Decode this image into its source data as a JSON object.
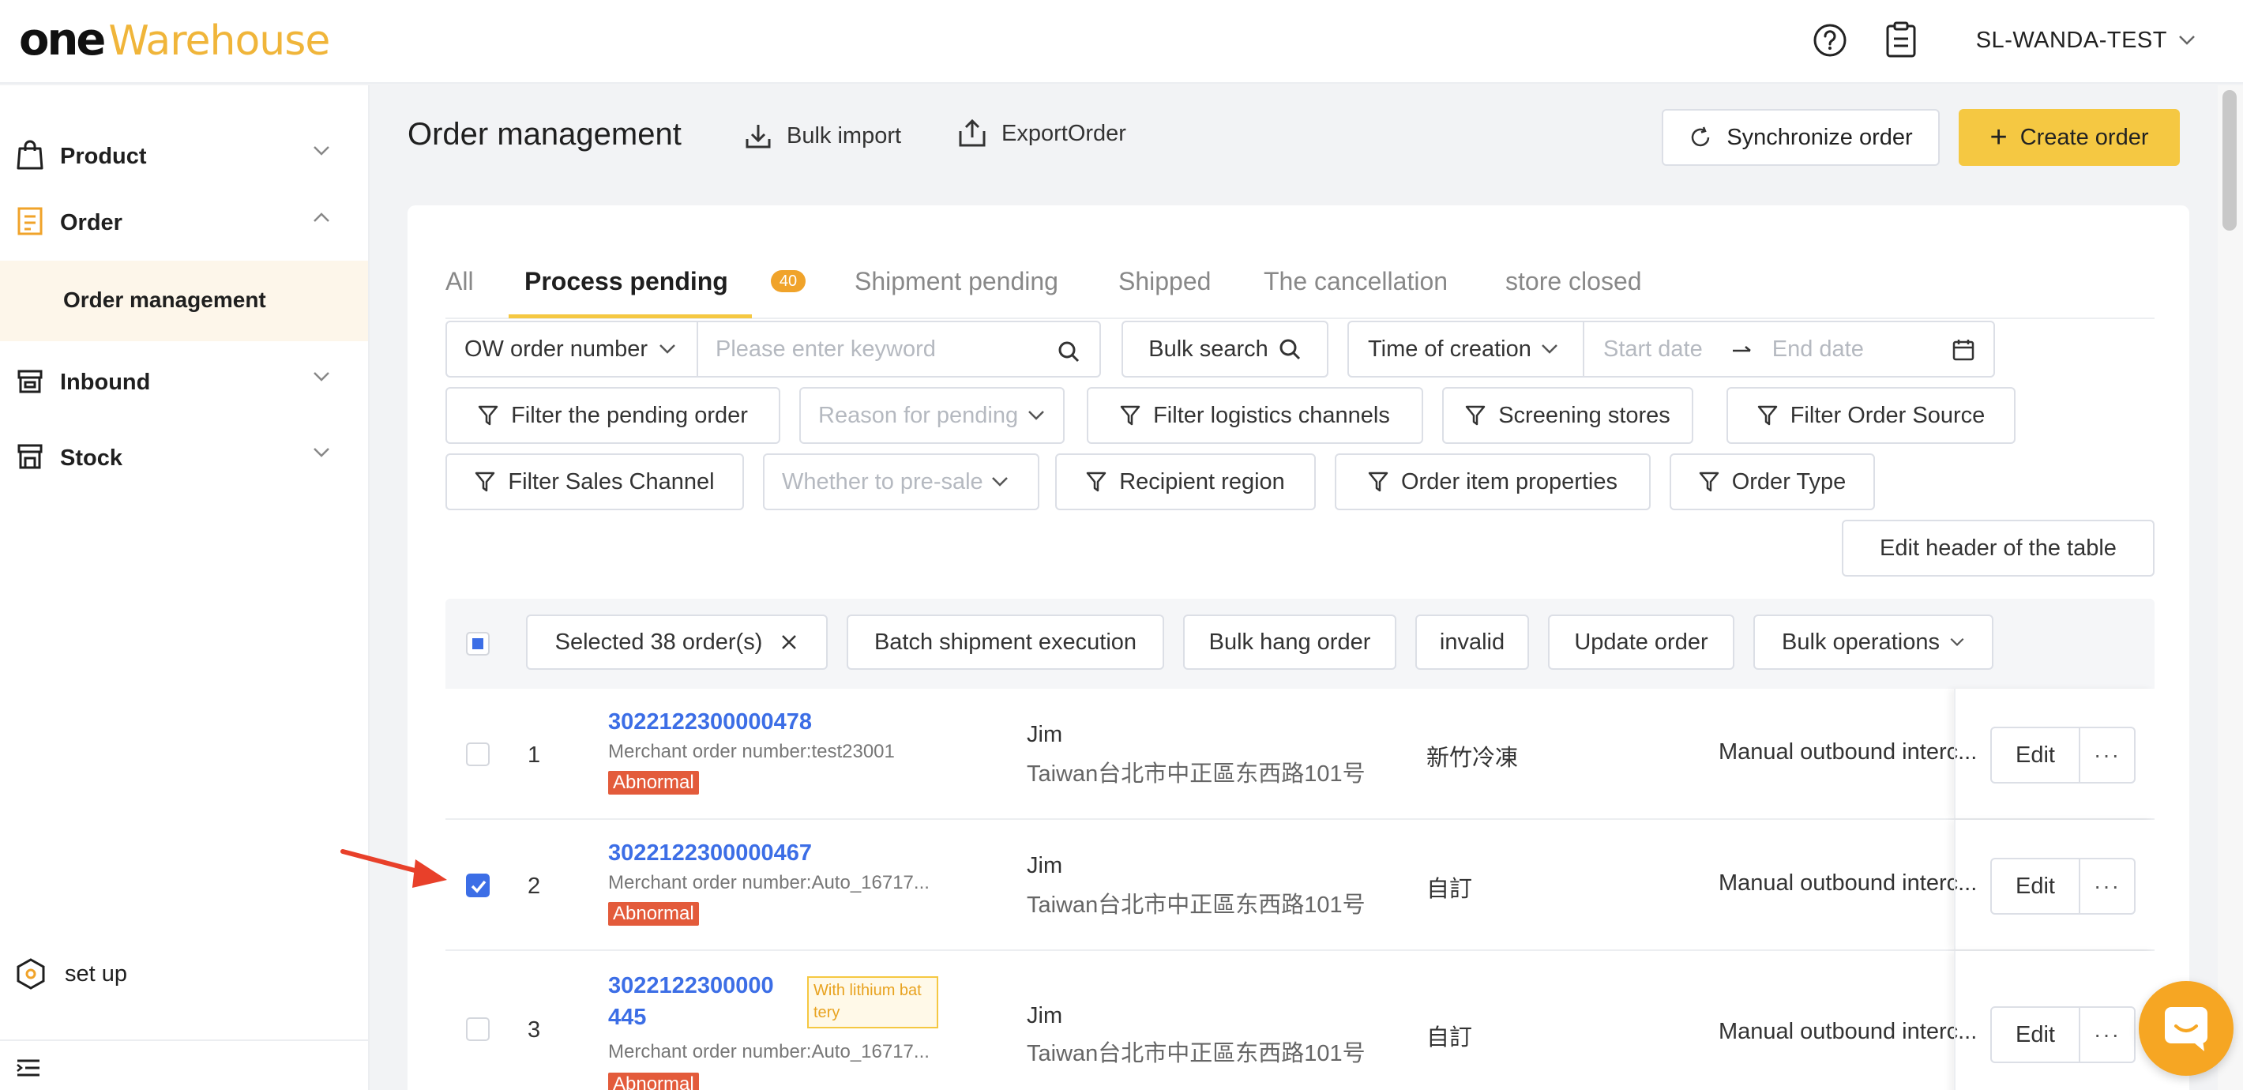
{
  "brand": {
    "part1": "one",
    "part2": "Warehouse",
    "accent": "#f0b53a"
  },
  "header": {
    "user": "SL-WANDA-TEST",
    "icons": [
      "help-icon",
      "clipboard-icon"
    ]
  },
  "sidebar": {
    "items": [
      {
        "label": "Product",
        "icon": "bag-icon",
        "expanded": false
      },
      {
        "label": "Order",
        "icon": "receipt-icon",
        "expanded": true,
        "children": [
          "Order management"
        ]
      },
      {
        "label": "Inbound",
        "icon": "inbound-icon",
        "expanded": false
      },
      {
        "label": "Stock",
        "icon": "stock-icon",
        "expanded": false
      }
    ],
    "setup": "set up"
  },
  "page": {
    "title": "Order management",
    "bulk_import": "Bulk import",
    "export": "ExportOrder",
    "sync": "Synchronize order",
    "create": "Create order"
  },
  "tabs": [
    {
      "label": "All"
    },
    {
      "label": "Process pending",
      "badge": "40",
      "active": true
    },
    {
      "label": "Shipment pending"
    },
    {
      "label": "Shipped"
    },
    {
      "label": "The cancellation"
    },
    {
      "label": "store closed"
    }
  ],
  "filters": {
    "search_field": "OW order number",
    "keyword_placeholder": "Please enter keyword",
    "bulk_search": "Bulk search",
    "time_field": "Time of creation",
    "start_placeholder": "Start date",
    "end_placeholder": "End date",
    "pending_order": "Filter the pending order",
    "reason_placeholder": "Reason for pending",
    "logistics": "Filter logistics channels",
    "stores": "Screening stores",
    "order_source": "Filter Order Source",
    "sales_channel": "Filter Sales Channel",
    "presale_placeholder": "Whether to pre-sale",
    "recipient_region": "Recipient region",
    "item_properties": "Order item properties",
    "order_type": "Order Type",
    "edit_header": "Edit header of the table"
  },
  "bulk": {
    "selected": "Selected 38 order(s)",
    "batch_shipment": "Batch shipment execution",
    "hang": "Bulk hang order",
    "invalid": "invalid",
    "update": "Update order",
    "operations": "Bulk operations"
  },
  "rows": [
    {
      "index": "1",
      "order_no": "3022122300000478",
      "merchant": "Merchant order number:test23001",
      "tag": "Abnormal",
      "name": "Jim",
      "address": "Taiwan台北市中正區东西路101号",
      "channel": "新竹冷凍",
      "status": "Manual outbound interc...",
      "checked": false
    },
    {
      "index": "2",
      "order_no": "3022122300000467",
      "merchant": "Merchant order number:Auto_16717...",
      "tag": "Abnormal",
      "name": "Jim",
      "address": "Taiwan台北市中正區东西路101号",
      "channel": "自訂",
      "status": "Manual outbound interc...",
      "checked": true
    },
    {
      "index": "3",
      "order_no_line1": "3022122300000",
      "order_no_line2": "445",
      "lithium_line1": "With lithium bat",
      "lithium_line2": "tery",
      "merchant": "Merchant order number:Auto_16717...",
      "tag": "Abnormal",
      "name": "Jim",
      "address": "Taiwan台北市中正區东西路101号",
      "channel": "自訂",
      "status": "Manual outbound interc...",
      "checked": false
    }
  ],
  "row_actions": {
    "edit": "Edit",
    "more": "···"
  },
  "colors": {
    "primary": "#3c6ee6",
    "accent": "#f5c842",
    "danger": "#e35b3b",
    "badge": "#f0a32a"
  }
}
